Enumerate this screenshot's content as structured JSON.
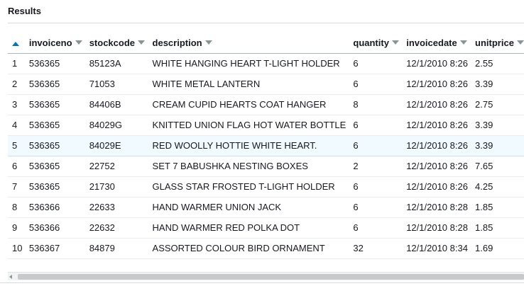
{
  "panel": {
    "title": "Results"
  },
  "table": {
    "sort": {
      "direction": "ascending"
    },
    "columns": [
      {
        "key": "row",
        "label": ""
      },
      {
        "key": "invoiceno",
        "label": "invoiceno"
      },
      {
        "key": "stockcode",
        "label": "stockcode"
      },
      {
        "key": "description",
        "label": "description"
      },
      {
        "key": "quantity",
        "label": "quantity"
      },
      {
        "key": "invoicedate",
        "label": "invoicedate"
      },
      {
        "key": "unitprice",
        "label": "unitprice"
      }
    ],
    "selected_row": 4,
    "rows": [
      [
        "1",
        "536365",
        "85123A",
        "WHITE HANGING HEART T-LIGHT HOLDER",
        "6",
        "12/1/2010 8:26",
        "2.55"
      ],
      [
        "2",
        "536365",
        "71053",
        "WHITE METAL LANTERN",
        "6",
        "12/1/2010 8:26",
        "3.39"
      ],
      [
        "3",
        "536365",
        "84406B",
        "CREAM CUPID HEARTS COAT HANGER",
        "8",
        "12/1/2010 8:26",
        "2.75"
      ],
      [
        "4",
        "536365",
        "84029G",
        "KNITTED UNION FLAG HOT WATER BOTTLE",
        "6",
        "12/1/2010 8:26",
        "3.39"
      ],
      [
        "5",
        "536365",
        "84029E",
        "RED WOOLLY HOTTIE WHITE HEART.",
        "6",
        "12/1/2010 8:26",
        "3.39"
      ],
      [
        "6",
        "536365",
        "22752",
        "SET 7 BABUSHKA NESTING BOXES",
        "2",
        "12/1/2010 8:26",
        "7.65"
      ],
      [
        "7",
        "536365",
        "21730",
        "GLASS STAR FROSTED T-LIGHT HOLDER",
        "6",
        "12/1/2010 8:26",
        "4.25"
      ],
      [
        "8",
        "536366",
        "22633",
        "HAND WARMER UNION JACK",
        "6",
        "12/1/2010 8:28",
        "1.85"
      ],
      [
        "9",
        "536366",
        "22632",
        "HAND WARMER RED POLKA DOT",
        "6",
        "12/1/2010 8:28",
        "1.85"
      ],
      [
        "10",
        "536367",
        "84879",
        "ASSORTED COLOUR BIRD ORNAMENT",
        "32",
        "12/1/2010 8:34",
        "1.69"
      ]
    ]
  },
  "colors": {
    "sort_accent": "#0073bb",
    "selected_row_bg": "#f1faff",
    "text": "#16191f"
  }
}
